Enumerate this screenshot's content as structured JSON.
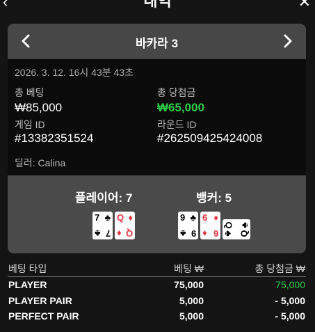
{
  "topbar": {
    "title": "내역",
    "back_icon": "‹",
    "close_icon": "✕"
  },
  "card": {
    "title": "바카라 3",
    "datetime": "2026. 3. 12. 16시 43분 43초",
    "total_bet_label": "총 베팅",
    "total_bet_value": "₩85,000",
    "total_win_label": "총 당첨금",
    "total_win_value": "₩65,000",
    "game_id_label": "게임 ID",
    "game_id_value": "#13382351524",
    "round_id_label": "라운드 ID",
    "round_id_value": "#262509425424008",
    "dealer": "딜러: Calina"
  },
  "results": {
    "player_label": "플레이어: 7",
    "banker_label": "뱅커: 5",
    "player_cards": [
      {
        "rank": "7",
        "suit": "♣",
        "color": "black",
        "orientation": "upright"
      },
      {
        "rank": "Q",
        "suit": "♦",
        "color": "red",
        "orientation": "upright"
      }
    ],
    "banker_cards": [
      {
        "rank": "9",
        "suit": "♣",
        "color": "black",
        "orientation": "upright"
      },
      {
        "rank": "6",
        "suit": "♦",
        "color": "red",
        "orientation": "upright"
      },
      {
        "rank": "Q",
        "suit": "♣",
        "color": "black",
        "orientation": "sideways"
      }
    ]
  },
  "table": {
    "headers": {
      "type": "베팅 타입",
      "bet": "베팅 ₩",
      "win": "총 당첨금 ₩"
    },
    "rows": [
      {
        "type": "PLAYER",
        "bet": "75,000",
        "win": "75,000",
        "win_positive": true
      },
      {
        "type": "PLAYER PAIR",
        "bet": "5,000",
        "win": "- 5,000",
        "win_positive": false
      },
      {
        "type": "PERFECT PAIR",
        "bet": "5,000",
        "win": "- 5,000",
        "win_positive": false
      }
    ]
  },
  "colors": {
    "win_green": "#2bcd48",
    "card_red": "#e5353e"
  }
}
